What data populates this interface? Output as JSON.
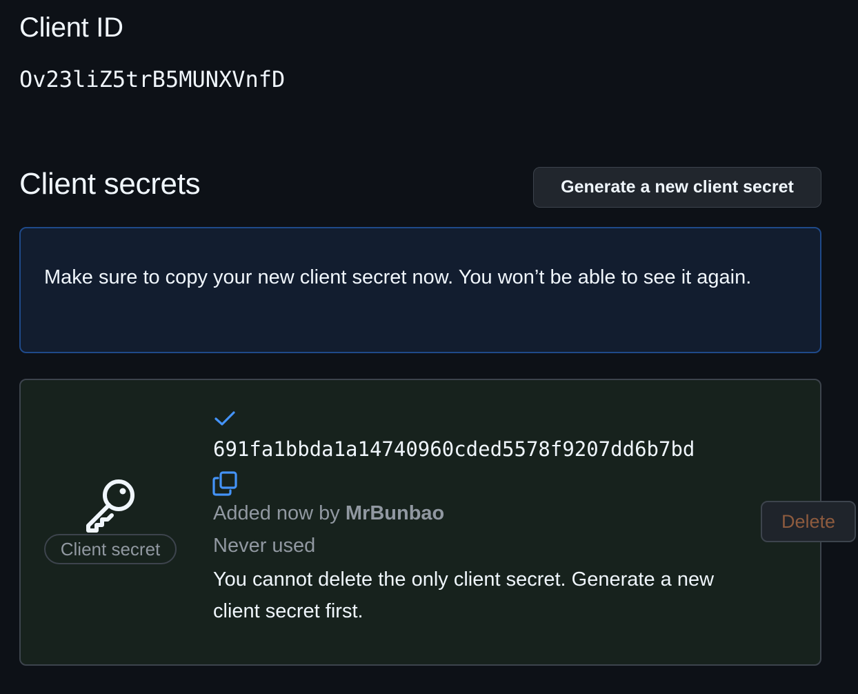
{
  "client_id": {
    "title": "Client ID",
    "value": "Ov23liZ5trB5MUNXVnfD"
  },
  "client_secrets": {
    "title": "Client secrets",
    "generate_button_label": "Generate a new client secret",
    "flash_message": "Make sure to copy your new client secret now. You won’t be able to see it again.",
    "secret": {
      "label": "Client secret",
      "value": "691fa1bbda1a14740960cded5578f9207dd6b7bd",
      "added_prefix": "Added now by",
      "added_by": "MrBunbao",
      "usage": "Never used",
      "delete_note": "You cannot delete the only client secret. Generate a new client secret first.",
      "delete_button_label": "Delete",
      "icons": [
        "key-icon",
        "check-icon",
        "copy-icon"
      ]
    }
  },
  "colors": {
    "background": "#0d1117",
    "accent_blue": "#4493f8",
    "flash_bg": "#121d2f",
    "secret_box_bg": "#17221d",
    "delete_text": "#8e5b3e"
  }
}
